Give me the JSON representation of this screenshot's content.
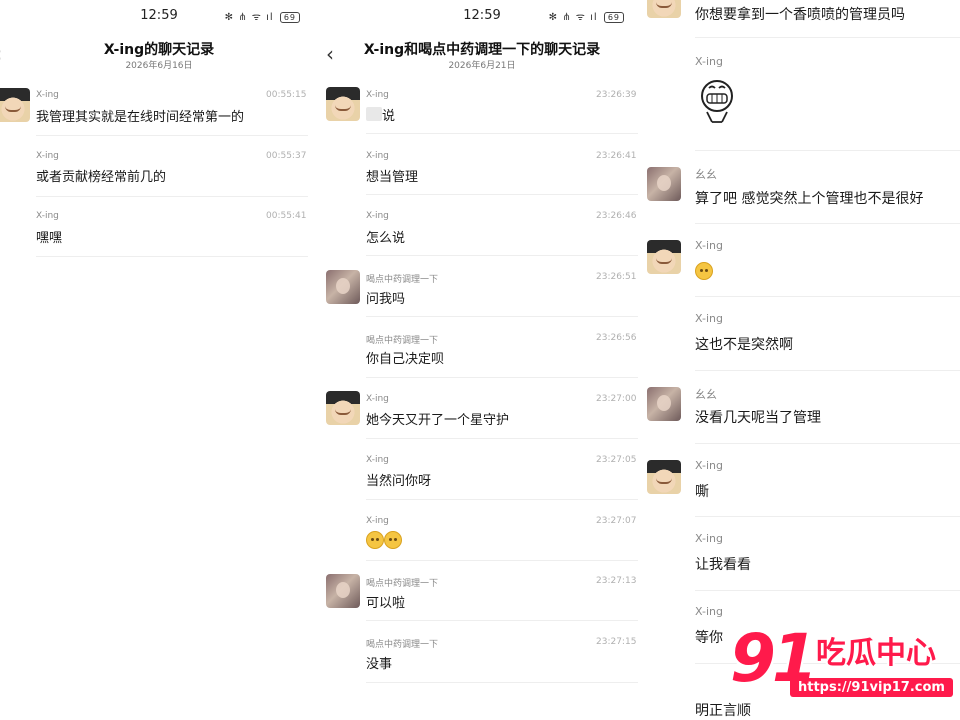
{
  "panel1": {
    "status_time": "12:59",
    "status_icons": "✻ ⋔ ᯤ ıl",
    "battery": "69",
    "title": "X-ing的聊天记录",
    "subtitle": "2026年6月16日",
    "messages": [
      {
        "sender": "X-ing",
        "time": "00:55:15",
        "text": "我管理其实就是在线时间经常第一的"
      },
      {
        "sender": "X-ing",
        "time": "00:55:37",
        "text": "或者贡献榜经常前几的"
      },
      {
        "sender": "X-ing",
        "time": "00:55:41",
        "text": "嘿嘿"
      }
    ]
  },
  "panel2": {
    "status_time": "12:59",
    "status_icons": "✻ ⋔ ᯤ ıl",
    "battery": "69",
    "back": "‹",
    "title": "X-ing和喝点中药调理一下的聊天记录",
    "subtitle": "2026年6月21日",
    "messages": [
      {
        "sender": "X-ing",
        "time": "23:26:39",
        "text": "说"
      },
      {
        "sender": "X-ing",
        "time": "23:26:41",
        "text": "想当管理"
      },
      {
        "sender": "X-ing",
        "time": "23:26:46",
        "text": "怎么说"
      },
      {
        "sender": "喝点中药调理一下",
        "time": "23:26:51",
        "text": "问我吗"
      },
      {
        "sender": "喝点中药调理一下",
        "time": "23:26:56",
        "text": "你自己决定呗"
      },
      {
        "sender": "X-ing",
        "time": "23:27:00",
        "text": "她今天又开了一个星守护"
      },
      {
        "sender": "X-ing",
        "time": "23:27:05",
        "text": "当然问你呀"
      },
      {
        "sender": "X-ing",
        "time": "23:27:07",
        "text": ""
      },
      {
        "sender": "喝点中药调理一下",
        "time": "23:27:13",
        "text": "可以啦"
      },
      {
        "sender": "喝点中药调理一下",
        "time": "23:27:15",
        "text": "没事"
      }
    ]
  },
  "panel3": {
    "messages": [
      {
        "sender": "",
        "text": "你想要拿到一个香喷喷的管理员吗"
      },
      {
        "sender": "X-ing",
        "text": ""
      },
      {
        "sender": "幺幺",
        "text": "算了吧 感觉突然上个管理也不是很好"
      },
      {
        "sender": "X-ing",
        "text": ""
      },
      {
        "sender": "X-ing",
        "text": "这也不是突然啊"
      },
      {
        "sender": "幺幺",
        "text": "没看几天呢当了管理"
      },
      {
        "sender": "X-ing",
        "text": "嘶"
      },
      {
        "sender": "X-ing",
        "text": "让我看看"
      },
      {
        "sender": "X-ing",
        "text": "等你"
      },
      {
        "sender": "",
        "text": "明正言顺"
      }
    ]
  },
  "watermark": {
    "number": "91",
    "name": "吃瓜中心",
    "url": "https://91vip17.com"
  }
}
